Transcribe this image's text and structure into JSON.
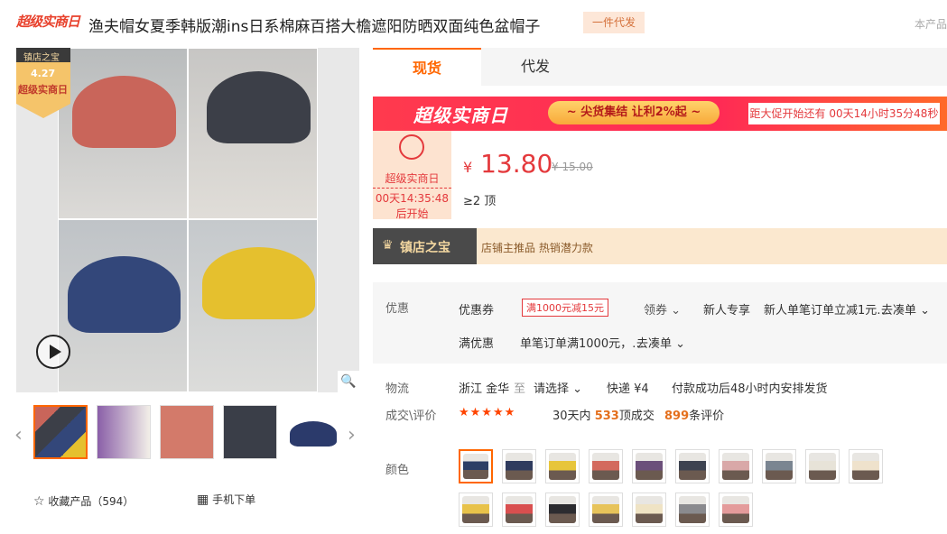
{
  "header": {
    "logo": "超级实商日",
    "title": "渔夫帽女夏季韩版潮ins日系棉麻百搭大檐遮阳防晒双面纯色盆帽子",
    "dropship_tag": "一件代发",
    "this_product": "本产品"
  },
  "gallery": {
    "badge_top": "镇店之宝",
    "badge_date": "4.27",
    "badge_event": "超级实商日",
    "zoom_icon": "search-icon",
    "play_icon": "play-icon"
  },
  "thumbs": [
    "#7a5a4a",
    "#a06a8a",
    "#d37a6a",
    "#3a3e48",
    "#2b3a6b"
  ],
  "actions": {
    "favorite": "收藏产品（594）",
    "mobile": "手机下单"
  },
  "tabs": [
    "现货",
    "代发"
  ],
  "banner": {
    "title": "超级实商日",
    "slogan": "~ 尖货集结 让利2%起 ~",
    "countdown": "距大促开始还有 00天14小时35分48秒"
  },
  "promo": {
    "label": "超级实商日",
    "time": "00天14:35:48",
    "start": "后开始"
  },
  "price": {
    "symbol": "¥",
    "value": "13.80",
    "old": "¥ 15.00",
    "moq": "≥2 顶"
  },
  "store": {
    "name": "镇店之宝",
    "desc": "店铺主推品  热销潜力款"
  },
  "deal": {
    "label": "优惠",
    "coupon_label": "优惠券",
    "coupon": "满1000元减15元",
    "get_coupon": "领券 ⌄",
    "newbie": "新人专享",
    "newbie_text": "新人单笔订单立减1元…",
    "go": "去凑单 ⌄",
    "full_label": "满优惠",
    "full_text": "单笔订单满1000元，…",
    "go2": "去凑单 ⌄"
  },
  "logistics": {
    "label": "物流",
    "from": "浙江 金华",
    "to": "至",
    "choose": "请选择  ⌄",
    "express": "快递 ¥4",
    "ship": "付款成功后48小时内安排发货"
  },
  "reviews": {
    "label": "成交\\评价",
    "stars": "★★★★★",
    "days": "30天内",
    "sold": "533",
    "sold_unit": "顶成交",
    "count": "899",
    "count_unit": "条评价"
  },
  "colors": {
    "label": "颜色",
    "swatches": [
      "#2d3f66",
      "#2f3b5e",
      "#e7c53a",
      "#d36a5e",
      "#6b4f7a",
      "#3d4350",
      "#d9a8a8",
      "#7a8591",
      "#e7e3d8",
      "#efe2cc",
      "#e8c24a",
      "#d94f4f",
      "#2c2c30",
      "#e7c35a",
      "#efe3c4",
      "#8a8a8e",
      "#e49b9b"
    ]
  }
}
